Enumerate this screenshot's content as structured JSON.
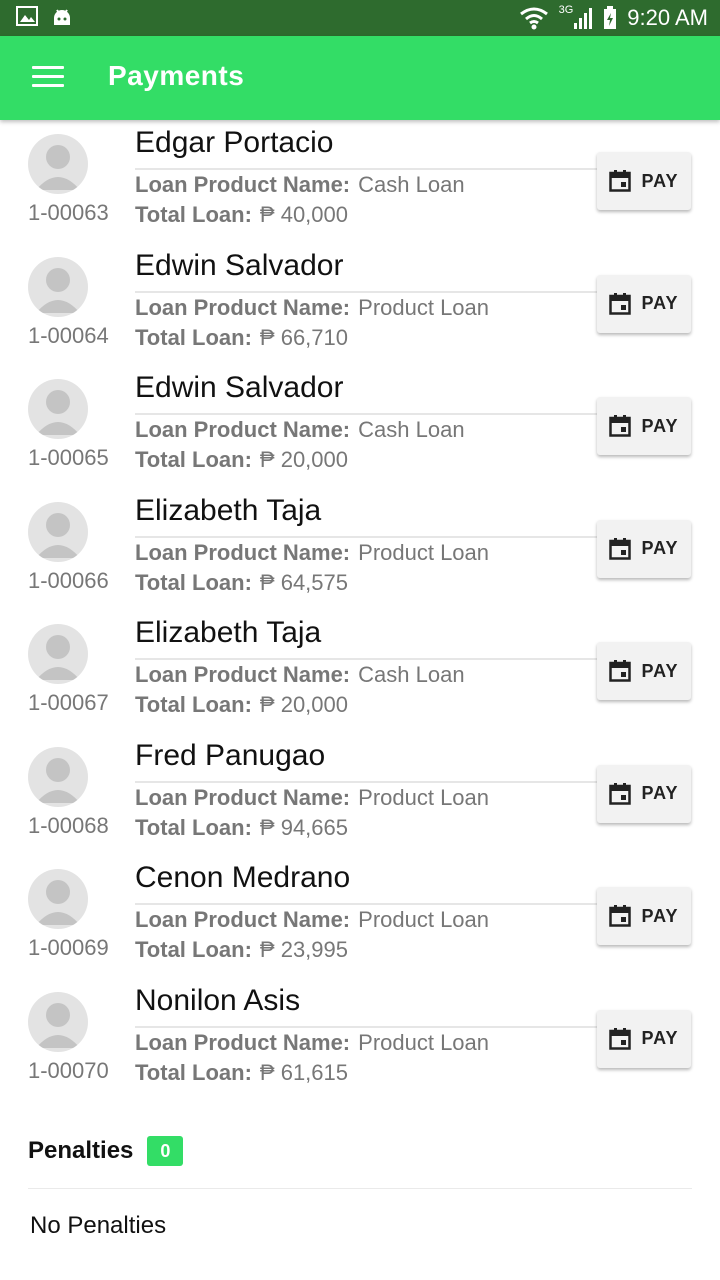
{
  "status_bar": {
    "network": "3G",
    "time": "9:20 AM"
  },
  "app_bar": {
    "title": "Payments"
  },
  "loan_labels": {
    "product": "Loan Product Name:",
    "total": "Total Loan:"
  },
  "loans": [
    {
      "name": "Edgar Portacio",
      "id": "1-00063",
      "product": "Cash Loan",
      "total": "₱ 40,000",
      "pay_label": "PAY"
    },
    {
      "name": "Edwin Salvador",
      "id": "1-00064",
      "product": "Product Loan",
      "total": "₱ 66,710",
      "pay_label": "PAY"
    },
    {
      "name": "Edwin Salvador",
      "id": "1-00065",
      "product": "Cash Loan",
      "total": "₱ 20,000",
      "pay_label": "PAY"
    },
    {
      "name": "Elizabeth Taja",
      "id": "1-00066",
      "product": "Product Loan",
      "total": "₱ 64,575",
      "pay_label": "PAY"
    },
    {
      "name": "Elizabeth Taja",
      "id": "1-00067",
      "product": "Cash Loan",
      "total": "₱ 20,000",
      "pay_label": "PAY"
    },
    {
      "name": "Fred Panugao",
      "id": "1-00068",
      "product": "Product Loan",
      "total": "₱ 94,665",
      "pay_label": "PAY"
    },
    {
      "name": "Cenon Medrano",
      "id": "1-00069",
      "product": "Product Loan",
      "total": "₱ 23,995",
      "pay_label": "PAY"
    },
    {
      "name": "Nonilon Asis",
      "id": "1-00070",
      "product": "Product Loan",
      "total": "₱ 61,615",
      "pay_label": "PAY"
    }
  ],
  "penalties": {
    "title": "Penalties",
    "count": "0",
    "empty_text": "No Penalties"
  },
  "colors": {
    "status_bar": "#2e6b2e",
    "accent": "#33dd66"
  },
  "icons": {
    "menu": "menu-icon",
    "pay": "calendar-icon",
    "avatar": "person-icon"
  }
}
